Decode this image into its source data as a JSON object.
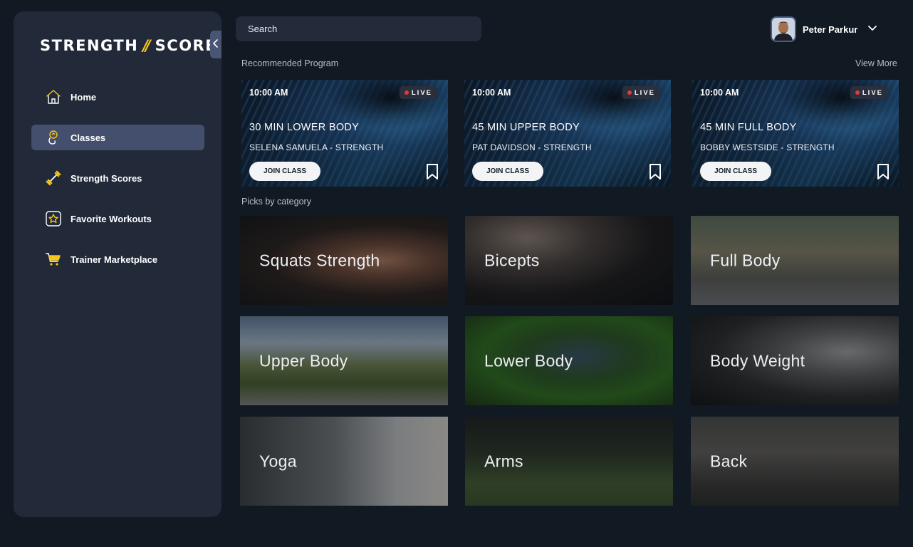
{
  "brand": {
    "left": "STRENGTH",
    "sep": "//",
    "right": "SCORE"
  },
  "sidebar": {
    "items": [
      {
        "label": "Home",
        "icon": "home-icon",
        "active": false
      },
      {
        "label": "Classes",
        "icon": "classes-icon",
        "active": true
      },
      {
        "label": "Strength Scores",
        "icon": "dumbbell-icon",
        "active": false
      },
      {
        "label": "Favorite Workouts",
        "icon": "star-icon",
        "active": false
      },
      {
        "label": "Trainer Marketplace",
        "icon": "cart-icon",
        "active": false
      }
    ]
  },
  "search": {
    "placeholder": "Search"
  },
  "user": {
    "name": "Peter Parkur"
  },
  "recommended": {
    "title": "Recommended Program",
    "view_more": "View More",
    "live_label": "LIVE",
    "join_label": "JOIN CLASS",
    "cards": [
      {
        "time": "10:00 AM",
        "title": "30 MIN LOWER BODY",
        "subtitle": "SELENA SAMUELA - STRENGTH"
      },
      {
        "time": "10:00 AM",
        "title": "45 MIN UPPER BODY",
        "subtitle": "PAT DAVIDSON - STRENGTH"
      },
      {
        "time": "10:00 AM",
        "title": "45 MIN FULL BODY",
        "subtitle": "BOBBY WESTSIDE - STRENGTH"
      }
    ]
  },
  "categories": {
    "title": "Picks by category",
    "items": [
      {
        "label": "Squats Strength"
      },
      {
        "label": "Bicepts"
      },
      {
        "label": "Full Body"
      },
      {
        "label": "Upper Body"
      },
      {
        "label": "Lower Body"
      },
      {
        "label": "Body Weight"
      },
      {
        "label": "Yoga"
      },
      {
        "label": "Arms"
      },
      {
        "label": "Back"
      }
    ]
  },
  "colors": {
    "accent": "#f5c518",
    "background": "#111923",
    "sidebar": "#222a3a",
    "active": "#444f6d",
    "live": "#e53935"
  }
}
